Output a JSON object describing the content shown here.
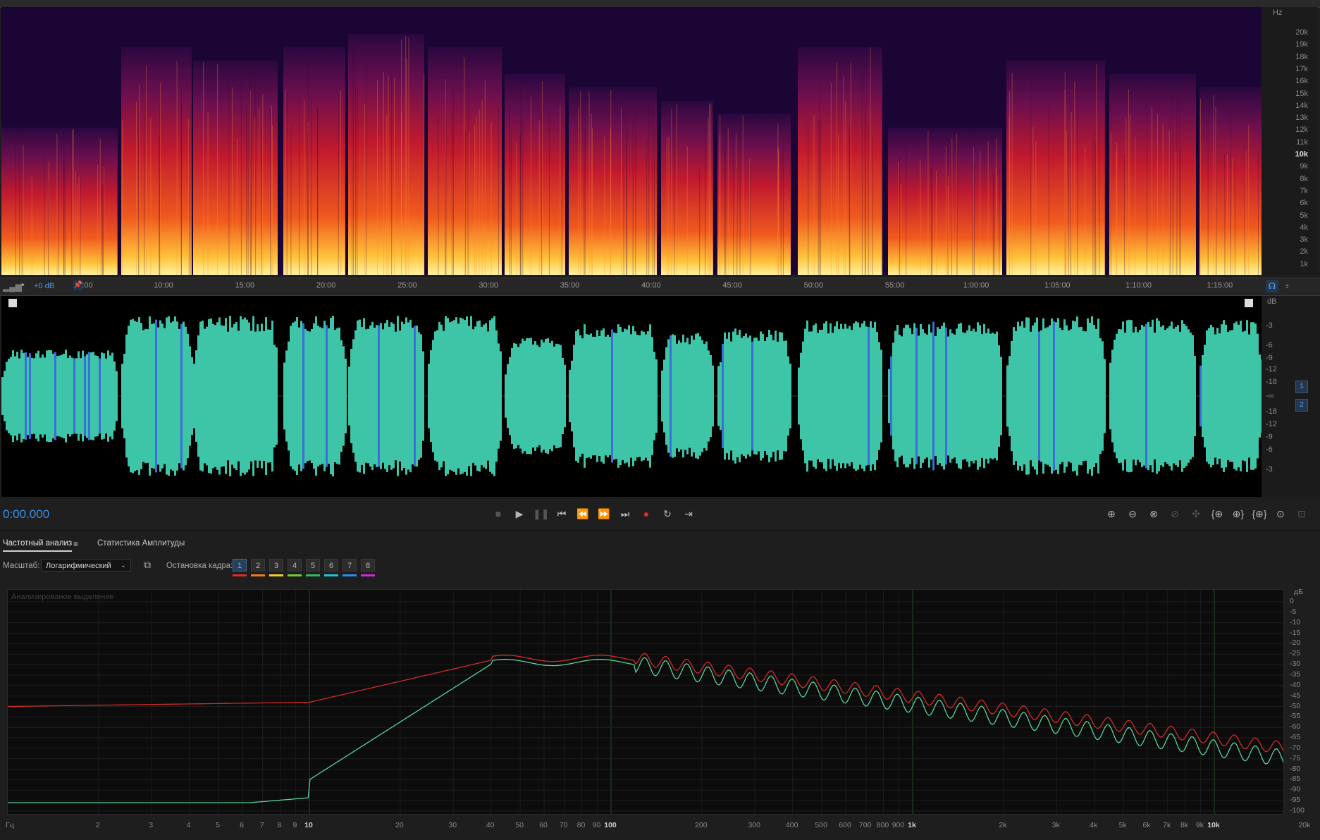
{
  "spectrogram": {
    "unit_label": "Hz",
    "freq_labels": [
      "20k",
      "19k",
      "18k",
      "17k",
      "16k",
      "15k",
      "14k",
      "13k",
      "12k",
      "11k",
      "10k",
      "9k",
      "8k",
      "7k",
      "6k",
      "5k",
      "4k",
      "3k",
      "2k",
      "1k"
    ]
  },
  "time_ruler": {
    "gain_label": "+0 dB",
    "start_label": ":00",
    "ticks": [
      "10:00",
      "15:00",
      "20:00",
      "25:00",
      "30:00",
      "35:00",
      "40:00",
      "45:00",
      "50:00",
      "55:00",
      "1:00:00",
      "1:05:00",
      "1:10:00",
      "1:15:00"
    ]
  },
  "waveform": {
    "unit_label": "dB",
    "db_labels": [
      "-3",
      "-6",
      "-9",
      "-12",
      "-18",
      "-∞",
      "-18",
      "-12",
      "-9",
      "-6",
      "-3"
    ],
    "channels": [
      "1",
      "2"
    ],
    "colors": {
      "wave": "#3ec4a6",
      "wave_peak": "#3a6fd6"
    }
  },
  "transport": {
    "timecode": "0:00.000",
    "buttons": [
      "stop-icon",
      "play-icon",
      "pause-icon",
      "goto-start-icon",
      "rewind-icon",
      "fast-forward-icon",
      "goto-end-icon",
      "record-icon",
      "loop-icon",
      "skip-icon"
    ],
    "zoom_buttons": [
      "zoom-in-amplitude-icon",
      "zoom-out-amplitude-icon",
      "zoom-reset-icon",
      "zoom-in-selection-icon",
      "zoom-fit-icon",
      "zoom-in-left-icon",
      "zoom-in-right-icon",
      "zoom-full-icon",
      "zoom-time-icon",
      "zoom-extra-icon"
    ]
  },
  "panel": {
    "tabs": [
      "Частотный анализ",
      "Статистика Амплитуды"
    ],
    "menu_icon": "≡",
    "scale_label": "Масштаб:",
    "scale_value": "Логарифмический",
    "freeze_label": "Остановка кадра:",
    "freeze_buttons": [
      "1",
      "2",
      "3",
      "4",
      "5",
      "6",
      "7",
      "8"
    ],
    "freeze_colors": [
      "#e02a2a",
      "#ef7a1c",
      "#f0d21f",
      "#6ed12a",
      "#2ac05a",
      "#22c2d8",
      "#2a8cf0",
      "#d02ad8"
    ],
    "graph_label": "Анализированое выделение",
    "db_unit": "дБ",
    "db_labels": [
      "0",
      "-5",
      "-10",
      "-15",
      "-20",
      "-25",
      "-30",
      "-35",
      "-40",
      "-45",
      "-50",
      "-55",
      "-60",
      "-65",
      "-70",
      "-75",
      "-80",
      "-85",
      "-90",
      "-95",
      "-100"
    ],
    "hz_unit": "Гц",
    "hz_labels": [
      "2",
      "3",
      "4",
      "5",
      "6",
      "7",
      "8",
      "9",
      "10",
      "20",
      "30",
      "40",
      "50",
      "60",
      "70",
      "80",
      "90",
      "100",
      "200",
      "300",
      "400",
      "500",
      "600",
      "700",
      "800",
      "900",
      "1k",
      "2k",
      "3k",
      "4k",
      "5k",
      "6k",
      "7k",
      "8k",
      "9k",
      "10k",
      "20k"
    ],
    "series_colors": {
      "left": "#d02b2b",
      "right": "#57d39a"
    }
  }
}
